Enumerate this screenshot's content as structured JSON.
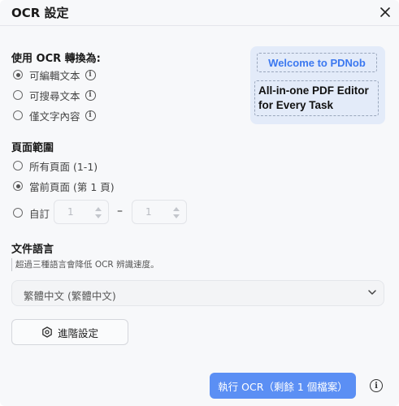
{
  "dialog": {
    "title": "OCR 設定",
    "close_icon": "close-icon"
  },
  "convert_section": {
    "title": "使用 OCR 轉換為:",
    "options": [
      {
        "label": "可編輯文本",
        "checked": true,
        "info_icon": "info-icon"
      },
      {
        "label": "可搜尋文本",
        "checked": false,
        "info_icon": "info-icon"
      },
      {
        "label": "僅文字內容",
        "checked": false,
        "info_icon": "info-icon"
      }
    ]
  },
  "preview": {
    "welcome": "Welcome to PDNob",
    "tagline_line1": "All-in-one PDF Editor",
    "tagline_line2": "for Every Task"
  },
  "page_range_section": {
    "title": "頁面範圍",
    "options": [
      {
        "label": "所有頁面 (1-1)",
        "checked": false
      },
      {
        "label": "當前頁面 (第 1 頁)",
        "checked": true
      },
      {
        "label": "自訂",
        "checked": false
      }
    ],
    "custom_from": "1",
    "range_separator": "–",
    "custom_to": "1"
  },
  "language_section": {
    "title": "文件語言",
    "note": "超過三種語言會降低 OCR 辨識速度。",
    "selected_language": "繁體中文 (繁體中文)"
  },
  "advanced_button": {
    "label": "進階設定",
    "icon": "settings-gear-icon"
  },
  "run_button": {
    "label": "執行 OCR（剩餘 1 個檔案）"
  },
  "colors": {
    "accent": "#5b8ff4",
    "brand_text": "#3b78f0",
    "preview_bg": "#e3ebf9",
    "background": "#f7f8fa"
  }
}
